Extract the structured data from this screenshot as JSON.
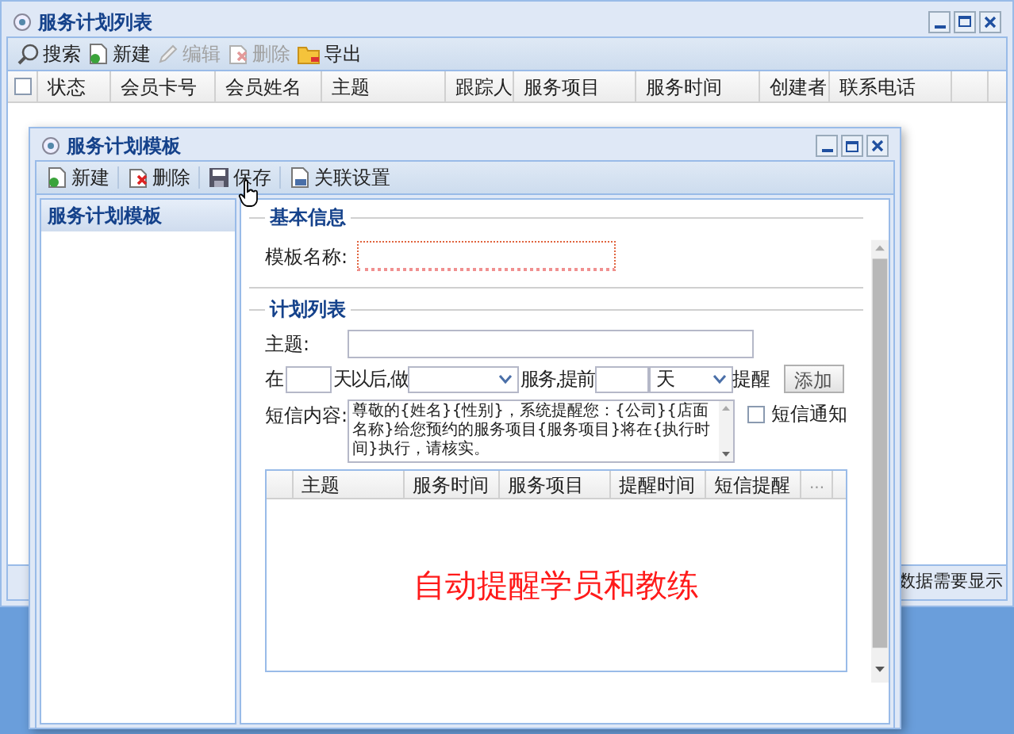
{
  "main_window": {
    "title": "服务计划列表",
    "toolbar": [
      {
        "label": "搜索",
        "kind": "search",
        "disabled": false
      },
      {
        "label": "新建",
        "kind": "new",
        "disabled": false
      },
      {
        "label": "编辑",
        "kind": "edit",
        "disabled": true
      },
      {
        "label": "删除",
        "kind": "delete",
        "disabled": true
      },
      {
        "label": "导出",
        "kind": "export",
        "disabled": false
      }
    ],
    "header_checkbox": {
      "checked": false
    },
    "columns": [
      "状态",
      "会员卡号",
      "会员姓名",
      "主题",
      "跟踪人",
      "服务项目",
      "服务时间",
      "创建者",
      "联系电话"
    ],
    "status_text": "数据需要显示"
  },
  "dialog": {
    "title": "服务计划模板",
    "toolbar": [
      {
        "label": "新建",
        "kind": "new",
        "disabled": false
      },
      {
        "label": "删除",
        "kind": "delete",
        "disabled": false
      },
      {
        "label": "保存",
        "kind": "save",
        "disabled": false
      },
      {
        "label": "关联设置",
        "kind": "link",
        "disabled": false
      }
    ],
    "tree_title": "服务计划模板",
    "basic_info": {
      "legend": "基本信息",
      "name_label": "模板名称:",
      "name_invalid": true
    },
    "plan_list": {
      "legend": "计划列表",
      "subject_label": "主题:",
      "in_label": "在",
      "days_after_label": "天以后,做",
      "service_label": "服务,提前",
      "unit": "天",
      "remind_label": "提醒",
      "add_button": "添加",
      "sms_label": "短信内容:",
      "sms_text": "尊敬的{姓名}{性别}，系统提醒您：{公司}{店面名称}给您预约的服务项目{服务项目}将在{执行时间}执行，请核实。",
      "sms_notify": {
        "label": "短信通知",
        "checked": false
      },
      "columns": [
        "主题",
        "服务时间",
        "服务项目",
        "提醒时间",
        "短信提醒",
        "..."
      ],
      "caption": "自动提醒学员和教练"
    }
  }
}
